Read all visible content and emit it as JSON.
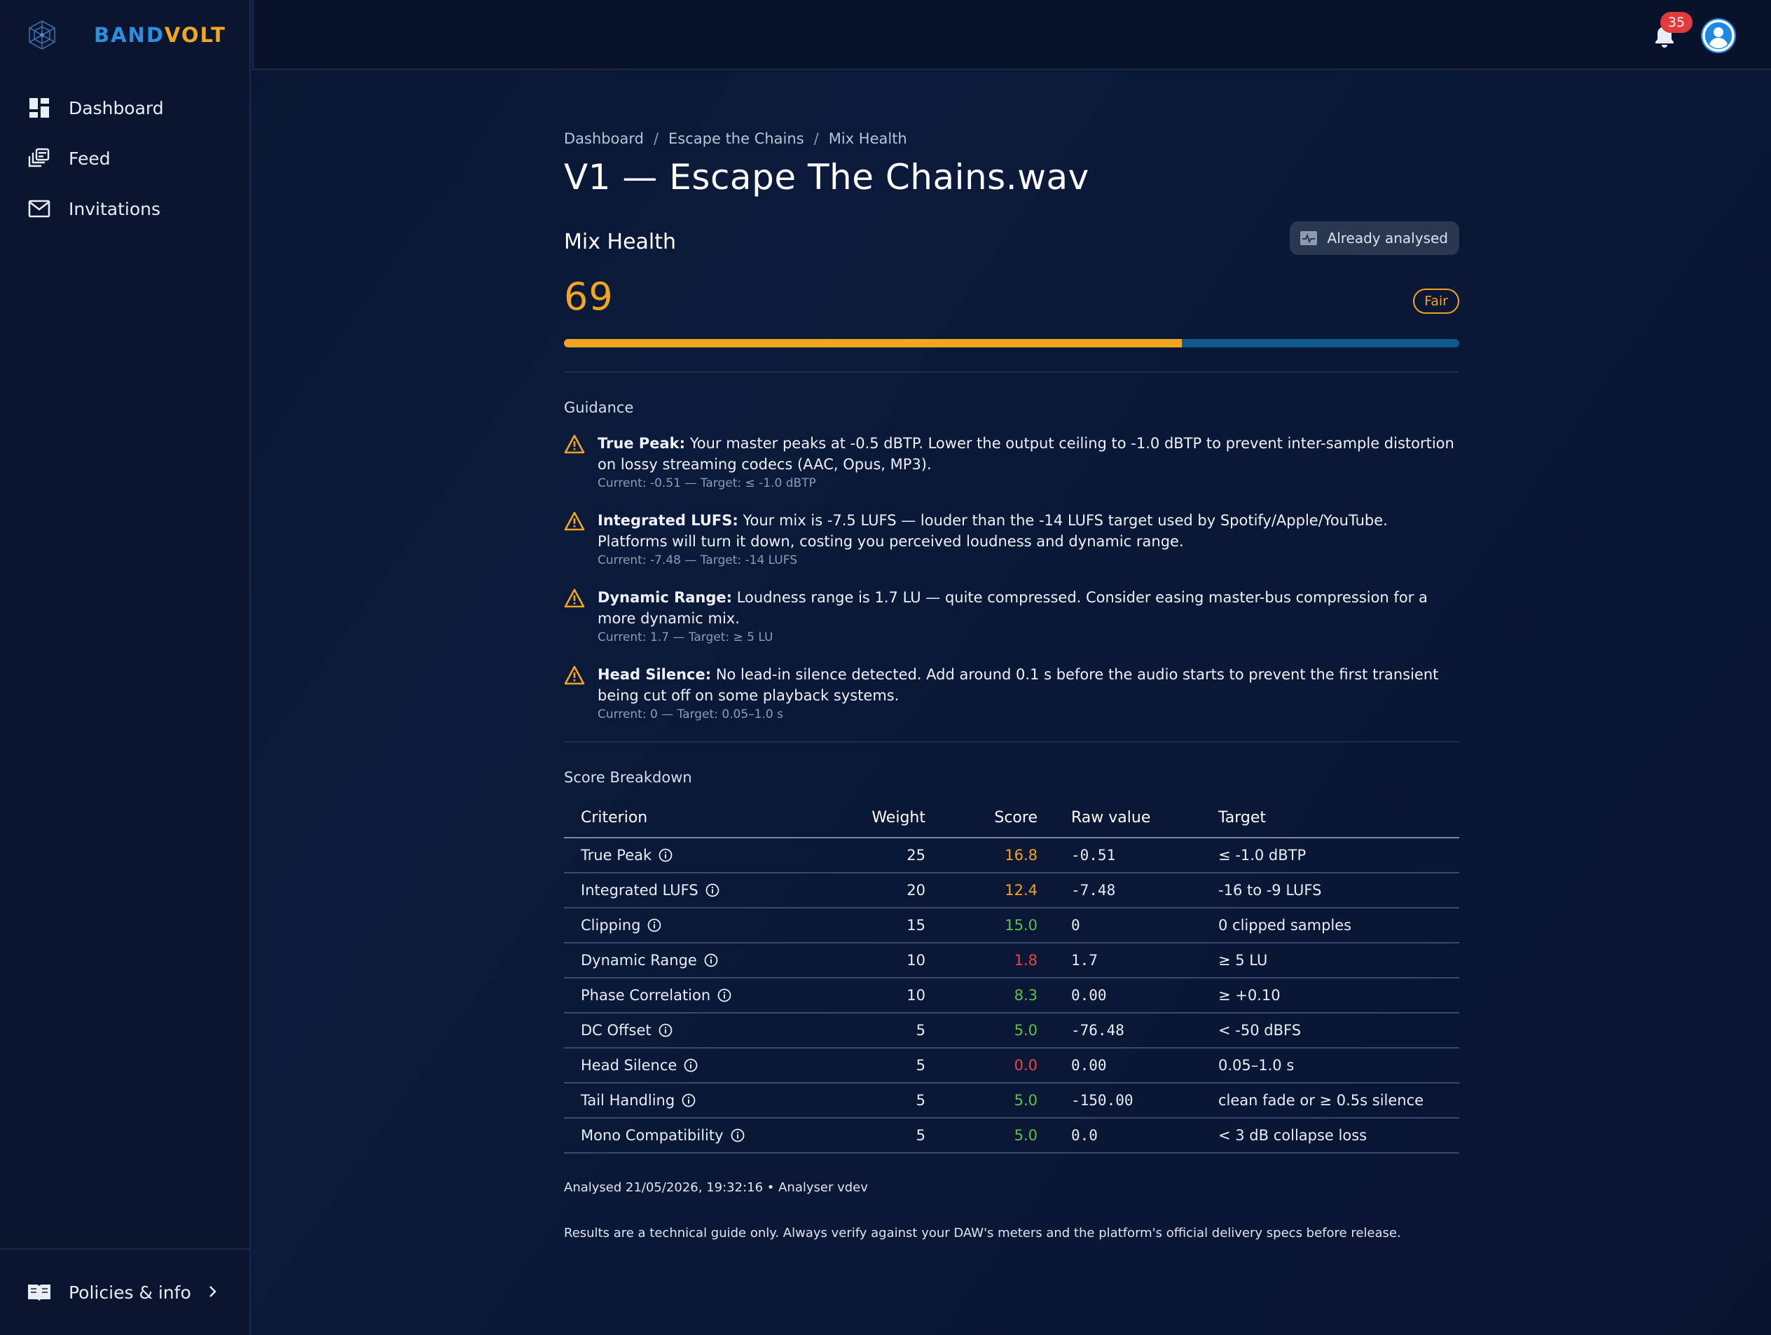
{
  "brand": {
    "part1": "BAND",
    "part2": "VOLT",
    "color1": "#2b8fe0",
    "color2": "#f2a51f"
  },
  "sidebar": {
    "items": [
      {
        "label": "Dashboard",
        "icon": "dashboard-icon"
      },
      {
        "label": "Feed",
        "icon": "feed-icon"
      },
      {
        "label": "Invitations",
        "icon": "mail-icon"
      }
    ],
    "footer_label": "Policies & info"
  },
  "topbar": {
    "notification_count": "35"
  },
  "breadcrumb": {
    "items": [
      "Dashboard",
      "Escape the Chains",
      "Mix Health"
    ],
    "sep": "/"
  },
  "page_title": "V1 — Escape The Chains.wav",
  "mix_health": {
    "title": "Mix Health",
    "analysed_label": "Already analysed",
    "score": "69",
    "score_fraction": 0.69,
    "rating": "Fair"
  },
  "guidance": {
    "title": "Guidance",
    "items": [
      {
        "label": "True Peak:",
        "text": " Your master peaks at -0.5 dBTP. Lower the output ceiling to -1.0 dBTP to prevent inter-sample distortion on lossy streaming codecs (AAC, Opus, MP3).",
        "meta": "Current: -0.51 — Target: ≤ -1.0 dBTP"
      },
      {
        "label": "Integrated LUFS:",
        "text": " Your mix is -7.5 LUFS — louder than the -14 LUFS target used by Spotify/Apple/YouTube. Platforms will turn it down, costing you perceived loudness and dynamic range.",
        "meta": "Current: -7.48 — Target: -14 LUFS"
      },
      {
        "label": "Dynamic Range:",
        "text": " Loudness range is 1.7 LU — quite compressed. Consider easing master-bus compression for a more dynamic mix.",
        "meta": "Current: 1.7 — Target: ≥ 5 LU"
      },
      {
        "label": "Head Silence:",
        "text": " No lead-in silence detected. Add around 0.1 s before the audio starts to prevent the first transient being cut off on some playback systems.",
        "meta": "Current: 0 — Target: 0.05–1.0 s"
      }
    ]
  },
  "breakdown": {
    "title": "Score Breakdown",
    "headers": {
      "criterion": "Criterion",
      "weight": "Weight",
      "score": "Score",
      "raw": "Raw value",
      "target": "Target"
    },
    "colors": {
      "orange": "#f2a51f",
      "green": "#5cc04a",
      "red": "#e94545"
    },
    "rows": [
      {
        "criterion": "True Peak",
        "weight": "25",
        "score": "16.8",
        "status": "orange",
        "raw": "-0.51",
        "target": "≤ -1.0 dBTP"
      },
      {
        "criterion": "Integrated LUFS",
        "weight": "20",
        "score": "12.4",
        "status": "orange",
        "raw": "-7.48",
        "target": "-16 to -9 LUFS"
      },
      {
        "criterion": "Clipping",
        "weight": "15",
        "score": "15.0",
        "status": "green",
        "raw": "0",
        "target": "0 clipped samples"
      },
      {
        "criterion": "Dynamic Range",
        "weight": "10",
        "score": "1.8",
        "status": "red",
        "raw": "1.7",
        "target": "≥ 5 LU"
      },
      {
        "criterion": "Phase Correlation",
        "weight": "10",
        "score": "8.3",
        "status": "green",
        "raw": "0.00",
        "target": "≥ +0.10"
      },
      {
        "criterion": "DC Offset",
        "weight": "5",
        "score": "5.0",
        "status": "green",
        "raw": "-76.48",
        "target": "< -50 dBFS"
      },
      {
        "criterion": "Head Silence",
        "weight": "5",
        "score": "0.0",
        "status": "red",
        "raw": "0.00",
        "target": "0.05–1.0 s"
      },
      {
        "criterion": "Tail Handling",
        "weight": "5",
        "score": "5.0",
        "status": "green",
        "raw": "-150.00",
        "target": "clean fade or ≥ 0.5s silence"
      },
      {
        "criterion": "Mono Compatibility",
        "weight": "5",
        "score": "5.0",
        "status": "green",
        "raw": "0.0",
        "target": "< 3 dB collapse loss"
      }
    ]
  },
  "footer": {
    "analysed": "Analysed 21/05/2026, 19:32:16 • Analyser vdev",
    "disclaimer": "Results are a technical guide only. Always verify against your DAW's meters and the platform's official delivery specs before release."
  }
}
